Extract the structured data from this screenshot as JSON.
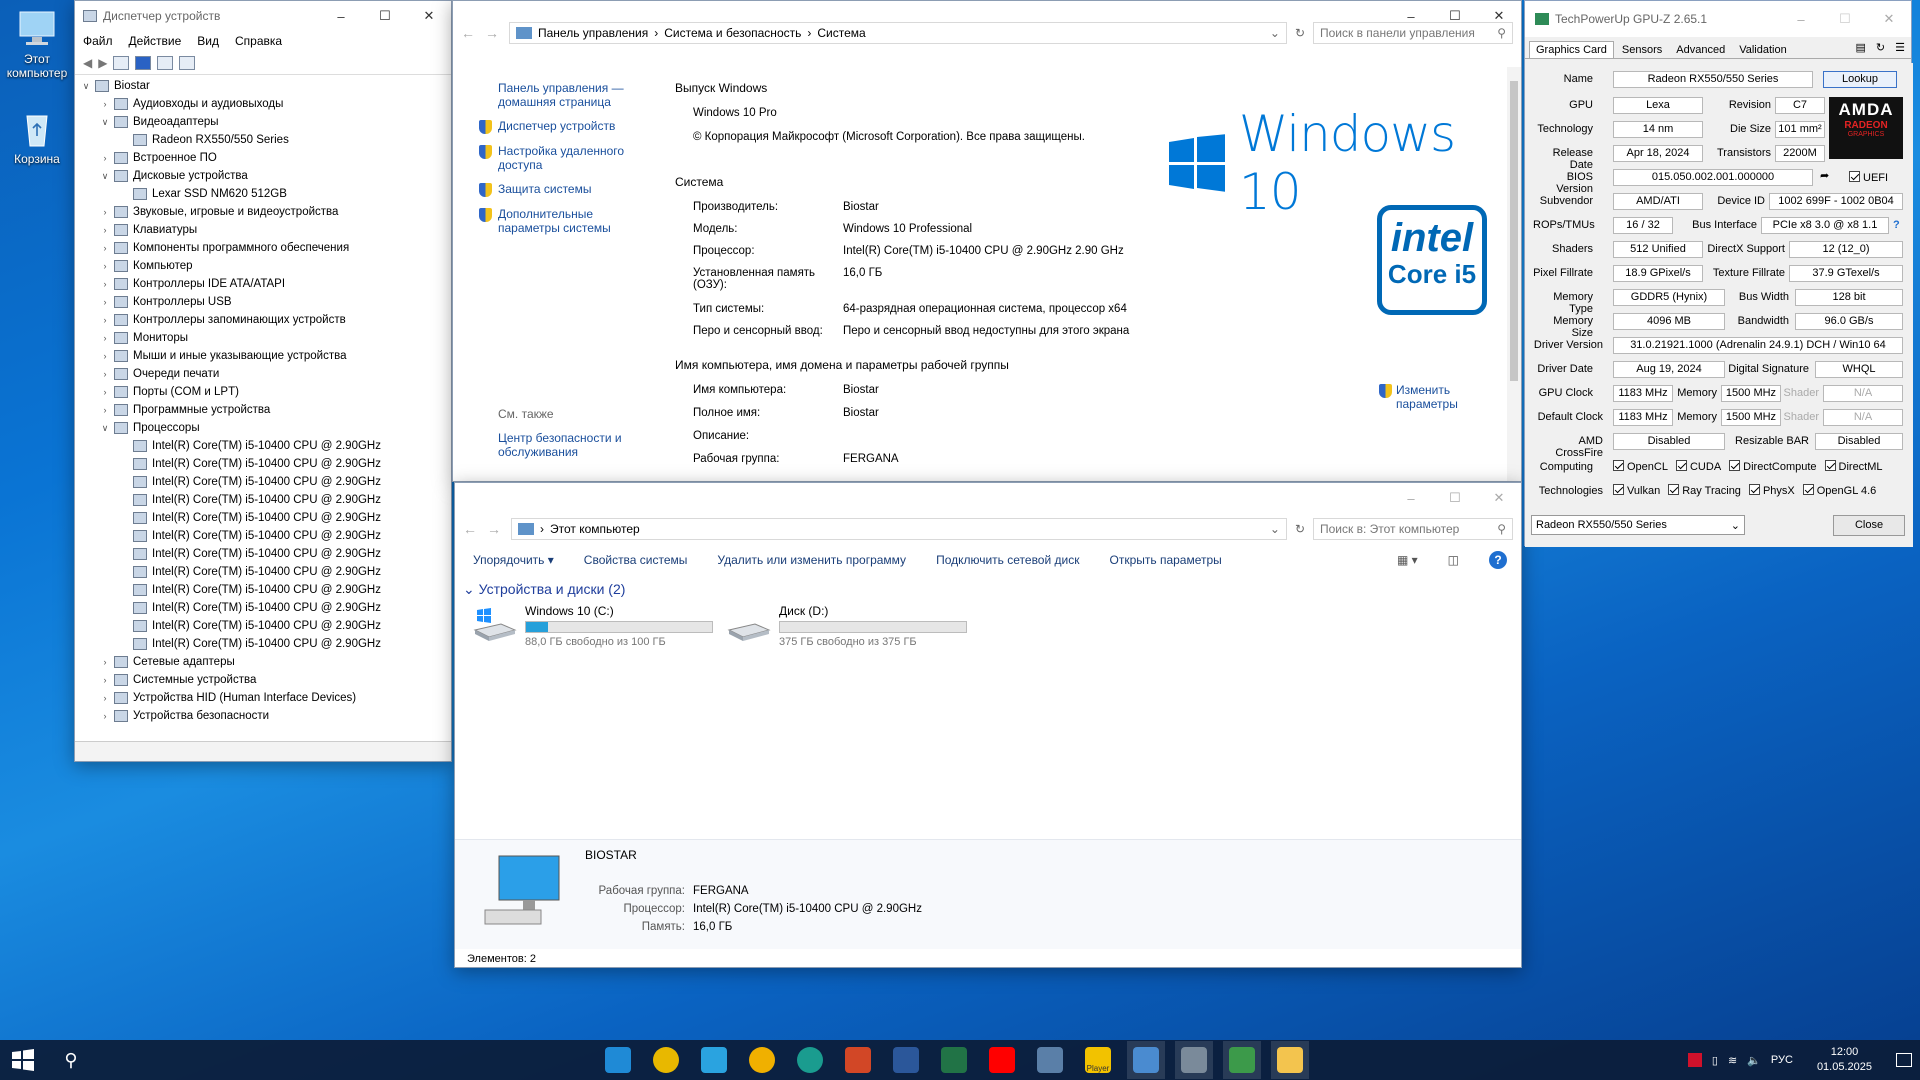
{
  "desktop": {
    "icons": [
      {
        "name": "this-pc",
        "label_lines": [
          "Этот",
          "компьютер"
        ]
      },
      {
        "name": "recycle-bin",
        "label_lines": [
          "Корзина"
        ]
      }
    ]
  },
  "device_manager": {
    "title": "Диспетчер устройств",
    "menu": [
      "Файл",
      "Действие",
      "Вид",
      "Справка"
    ],
    "tree": [
      {
        "label": "Biostar",
        "level": 0,
        "state": "open"
      },
      {
        "label": "Аудиовходы и аудиовыходы",
        "level": 1,
        "state": "closed"
      },
      {
        "label": "Видеоадаптеры",
        "level": 1,
        "state": "open"
      },
      {
        "label": "Radeon RX550/550 Series",
        "level": 2,
        "state": "leaf"
      },
      {
        "label": "Встроенное ПО",
        "level": 1,
        "state": "closed"
      },
      {
        "label": "Дисковые устройства",
        "level": 1,
        "state": "open"
      },
      {
        "label": "Lexar SSD NM620 512GB",
        "level": 2,
        "state": "leaf"
      },
      {
        "label": "Звуковые, игровые и видеоустройства",
        "level": 1,
        "state": "closed"
      },
      {
        "label": "Клавиатуры",
        "level": 1,
        "state": "closed"
      },
      {
        "label": "Компоненты программного обеспечения",
        "level": 1,
        "state": "closed"
      },
      {
        "label": "Компьютер",
        "level": 1,
        "state": "closed"
      },
      {
        "label": "Контроллеры IDE ATA/ATAPI",
        "level": 1,
        "state": "closed"
      },
      {
        "label": "Контроллеры USB",
        "level": 1,
        "state": "closed"
      },
      {
        "label": "Контроллеры запоминающих устройств",
        "level": 1,
        "state": "closed"
      },
      {
        "label": "Мониторы",
        "level": 1,
        "state": "closed"
      },
      {
        "label": "Мыши и иные указывающие устройства",
        "level": 1,
        "state": "closed"
      },
      {
        "label": "Очереди печати",
        "level": 1,
        "state": "closed"
      },
      {
        "label": "Порты (COM и LPT)",
        "level": 1,
        "state": "closed"
      },
      {
        "label": "Программные устройства",
        "level": 1,
        "state": "closed"
      },
      {
        "label": "Процессоры",
        "level": 1,
        "state": "open"
      },
      {
        "label": "Intel(R) Core(TM) i5-10400 CPU @ 2.90GHz",
        "level": 2,
        "state": "leaf"
      },
      {
        "label": "Intel(R) Core(TM) i5-10400 CPU @ 2.90GHz",
        "level": 2,
        "state": "leaf"
      },
      {
        "label": "Intel(R) Core(TM) i5-10400 CPU @ 2.90GHz",
        "level": 2,
        "state": "leaf"
      },
      {
        "label": "Intel(R) Core(TM) i5-10400 CPU @ 2.90GHz",
        "level": 2,
        "state": "leaf"
      },
      {
        "label": "Intel(R) Core(TM) i5-10400 CPU @ 2.90GHz",
        "level": 2,
        "state": "leaf"
      },
      {
        "label": "Intel(R) Core(TM) i5-10400 CPU @ 2.90GHz",
        "level": 2,
        "state": "leaf"
      },
      {
        "label": "Intel(R) Core(TM) i5-10400 CPU @ 2.90GHz",
        "level": 2,
        "state": "leaf"
      },
      {
        "label": "Intel(R) Core(TM) i5-10400 CPU @ 2.90GHz",
        "level": 2,
        "state": "leaf"
      },
      {
        "label": "Intel(R) Core(TM) i5-10400 CPU @ 2.90GHz",
        "level": 2,
        "state": "leaf"
      },
      {
        "label": "Intel(R) Core(TM) i5-10400 CPU @ 2.90GHz",
        "level": 2,
        "state": "leaf"
      },
      {
        "label": "Intel(R) Core(TM) i5-10400 CPU @ 2.90GHz",
        "level": 2,
        "state": "leaf"
      },
      {
        "label": "Intel(R) Core(TM) i5-10400 CPU @ 2.90GHz",
        "level": 2,
        "state": "leaf"
      },
      {
        "label": "Сетевые адаптеры",
        "level": 1,
        "state": "closed"
      },
      {
        "label": "Системные устройства",
        "level": 1,
        "state": "closed"
      },
      {
        "label": "Устройства HID (Human Interface Devices)",
        "level": 1,
        "state": "closed"
      },
      {
        "label": "Устройства безопасности",
        "level": 1,
        "state": "closed"
      }
    ]
  },
  "system": {
    "breadcrumb": [
      "Панель управления",
      "Система и безопасность",
      "Система"
    ],
    "search_placeholder": "Поиск в панели управления",
    "left_links": {
      "home": "Панель управления — домашняя страница",
      "items": [
        "Диспетчер устройств",
        "Настройка удаленного доступа",
        "Защита системы",
        "Дополнительные параметры системы"
      ],
      "see_also": "См. также",
      "security": "Центр безопасности и обслуживания"
    },
    "edition_header": "Выпуск Windows",
    "edition": "Windows 10 Pro",
    "copyright": "© Корпорация Майкрософт (Microsoft Corporation). Все права защищены.",
    "logo_text": "Windows 10",
    "system_header": "Система",
    "system_rows": [
      {
        "k": "Производитель:",
        "v": "Biostar"
      },
      {
        "k": "Модель:",
        "v": "Windows 10 Professional"
      },
      {
        "k": "Процессор:",
        "v": "Intel(R) Core(TM) i5-10400 CPU @ 2.90GHz   2.90 GHz"
      },
      {
        "k": "Установленная память (ОЗУ):",
        "v": "16,0 ГБ"
      },
      {
        "k": "Тип системы:",
        "v": "64-разрядная операционная система, процессор x64"
      },
      {
        "k": "Перо и сенсорный ввод:",
        "v": "Перо и сенсорный ввод недоступны для этого экрана"
      }
    ],
    "intel_badge": {
      "brand": "intel",
      "line": "Core i5"
    },
    "name_header": "Имя компьютера, имя домена и параметры рабочей группы",
    "name_rows": [
      {
        "k": "Имя компьютера:",
        "v": "Biostar"
      },
      {
        "k": "Полное имя:",
        "v": "Biostar"
      },
      {
        "k": "Описание:",
        "v": ""
      },
      {
        "k": "Рабочая группа:",
        "v": "FERGANA"
      }
    ],
    "change_link": "Изменить параметры"
  },
  "explorer": {
    "address": "Этот компьютер",
    "search_placeholder": "Поиск в: Этот компьютер",
    "commands": [
      "Упорядочить",
      "Свойства системы",
      "Удалить или изменить программу",
      "Подключить сетевой диск",
      "Открыть параметры"
    ],
    "group_title": "Устройства и диски (2)",
    "drives": [
      {
        "name": "Windows 10 (C:)",
        "info": "88,0 ГБ свободно из 100 ГБ",
        "used_fraction": 0.12
      },
      {
        "name": "Диск (D:)",
        "info": "375 ГБ свободно из 375 ГБ",
        "used_fraction": 0.0
      }
    ],
    "details": {
      "name": "BIOSTAR",
      "rows": [
        {
          "k": "Рабочая группа:",
          "v": "FERGANA"
        },
        {
          "k": "Процессор:",
          "v": "Intel(R) Core(TM) i5-10400 CPU @ 2.90GHz"
        },
        {
          "k": "Память:",
          "v": "16,0 ГБ"
        }
      ]
    },
    "status": "Элементов: 2"
  },
  "gpuz": {
    "title": "TechPowerUp GPU-Z 2.65.1",
    "tabs": [
      "Graphics Card",
      "Sensors",
      "Advanced",
      "Validation"
    ],
    "lookup": "Lookup",
    "uefi": "UEFI",
    "amd_logo": "AMDA",
    "radeon_logo": "RADEON",
    "radeon_sub": "GRAPHICS",
    "name_label": "Name",
    "name": "Radeon RX550/550 Series",
    "gpu_label": "GPU",
    "gpu": "Lexa",
    "revision_label": "Revision",
    "revision": "C7",
    "tech_label": "Technology",
    "tech": "14 nm",
    "die_label": "Die Size",
    "die": "101 mm²",
    "release_label": "Release Date",
    "release": "Apr 18, 2024",
    "trans_label": "Transistors",
    "trans": "2200M",
    "bios_label": "BIOS Version",
    "bios": "015.050.002.001.000000",
    "sub_label": "Subvendor",
    "sub": "AMD/ATI",
    "devid_label": "Device ID",
    "devid": "1002 699F - 1002 0B04",
    "rops_label": "ROPs/TMUs",
    "rops": "16 / 32",
    "bus_label": "Bus Interface",
    "bus": "PCIe x8 3.0 @ x8 1.1",
    "shaders_label": "Shaders",
    "shaders": "512 Unified",
    "dx_label": "DirectX Support",
    "dx": "12 (12_0)",
    "pix_label": "Pixel Fillrate",
    "pix": "18.9 GPixel/s",
    "tex_label": "Texture Fillrate",
    "tex": "37.9 GTexel/s",
    "mtype_label": "Memory Type",
    "mtype": "GDDR5 (Hynix)",
    "bw_label": "Bus Width",
    "bw": "128 bit",
    "msize_label": "Memory Size",
    "msize": "4096 MB",
    "band_label": "Bandwidth",
    "band": "96.0 GB/s",
    "drv_label": "Driver Version",
    "drv": "31.0.21921.1000 (Adrenalin 24.9.1) DCH / Win10 64",
    "drvd_label": "Driver Date",
    "drvd": "Aug 19, 2024",
    "sig_label": "Digital Signature",
    "sig": "WHQL",
    "gclk_label": "GPU Clock",
    "gclk": "1183 MHz",
    "mem_label": "Memory",
    "gmem": "1500 MHz",
    "shader_label": "Shader",
    "na": "N/A",
    "dclk_label": "Default Clock",
    "dclk": "1183 MHz",
    "dmem": "1500 MHz",
    "cf_label": "AMD CrossFire",
    "cf": "Disabled",
    "rbar_label": "Resizable BAR",
    "rbar": "Disabled",
    "comp_label": "Computing",
    "computing": [
      "OpenCL",
      "CUDA",
      "DirectCompute",
      "DirectML"
    ],
    "techs_label": "Technologies",
    "technologies": [
      "Vulkan",
      "Ray Tracing",
      "PhysX",
      "OpenGL 4.6"
    ],
    "select": "Radeon RX550/550 Series",
    "close": "Close"
  },
  "taskbar": {
    "lang": "РУС",
    "time": "12:00",
    "date": "01.05.2025",
    "app_icons": [
      "store-icon",
      "chrome-icon",
      "telegram-icon",
      "aimp-icon",
      "edge-icon",
      "powerpoint-icon",
      "word-icon",
      "excel-icon",
      "youtube-icon",
      "notebook-icon",
      "player-icon",
      "system-icon",
      "device-manager-icon",
      "gpuz-icon",
      "explorer-icon"
    ],
    "player_label": "Player"
  },
  "colors": {
    "accent": "#0a74d4",
    "link": "#1a4f9c",
    "win_blue": "#0078d7",
    "intel_blue": "#0068b5",
    "amd_red": "#c8102e"
  }
}
